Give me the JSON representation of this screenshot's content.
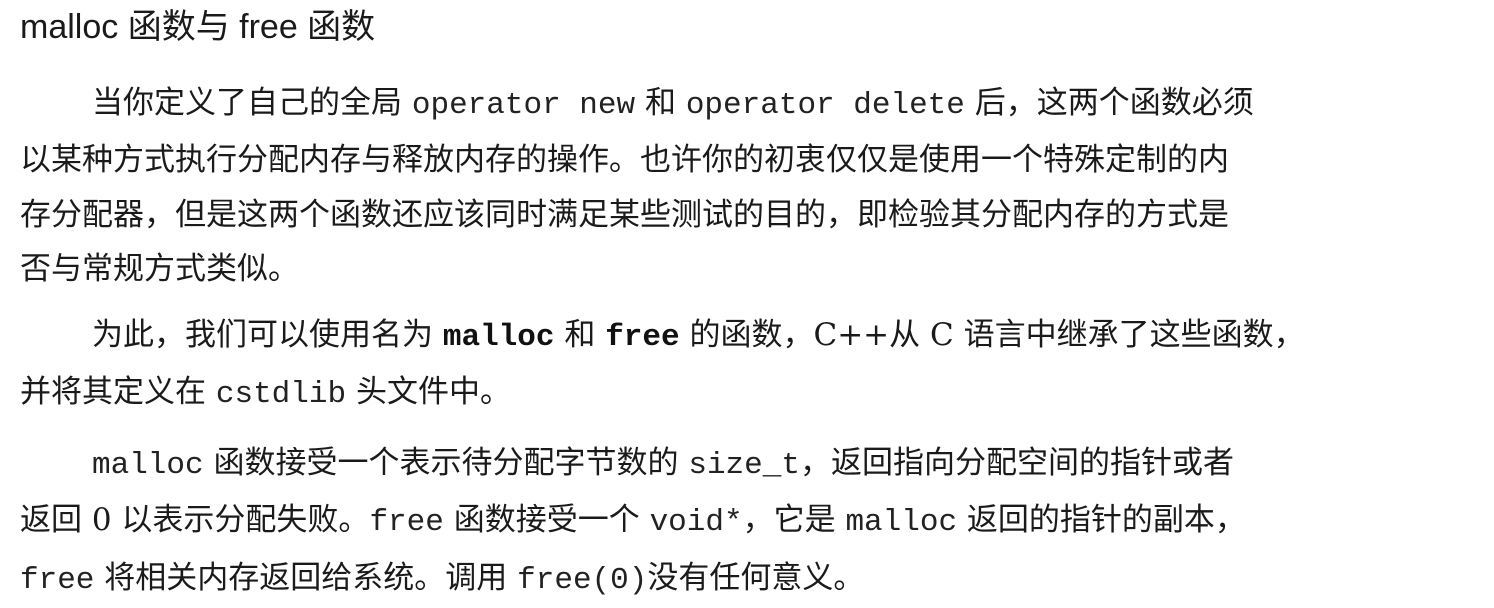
{
  "heading": "malloc 函数与 free 函数",
  "paragraph1": {
    "line1_a": "当你定义了自己的全局 ",
    "line1_code1": "operator new",
    "line1_b": " 和 ",
    "line1_code2": "operator delete",
    "line1_c": " 后，这两个函数必须",
    "line2": "以某种方式执行分配内存与释放内存的操作。也许你的初衷仅仅是使用一个特殊定制的内",
    "line3": "存分配器，但是这两个函数还应该同时满足某些测试的目的，即检验其分配内存的方式是",
    "line4": "否与常规方式类似。"
  },
  "paragraph2": {
    "line1_a": "为此，我们可以使用名为 ",
    "line1_code1": "malloc",
    "line1_b": " 和 ",
    "line1_code2": "free",
    "line1_c": " 的函数，C++从 C 语言中继承了这些函数，",
    "line2_a": "并将其定义在 ",
    "line2_code": "cstdlib",
    "line2_b": " 头文件中。"
  },
  "paragraph3": {
    "line1_code1": "malloc",
    "line1_a": " 函数接受一个表示待分配字节数的 ",
    "line1_code2": "size_t",
    "line1_b": "，返回指向分配空间的指针或者",
    "line2_a": "返回 0 以表示分配失败。",
    "line2_code1": "free",
    "line2_b": " 函数接受一个 ",
    "line2_code2": "void*",
    "line2_c": "，它是 ",
    "line2_code3": "malloc",
    "line2_d": " 返回的指针的副本，",
    "line3_code1": "free",
    "line3_a": " 将相关内存返回给系统。调用 ",
    "line3_code2": "free(0)",
    "line3_b": "没有任何意义。"
  }
}
